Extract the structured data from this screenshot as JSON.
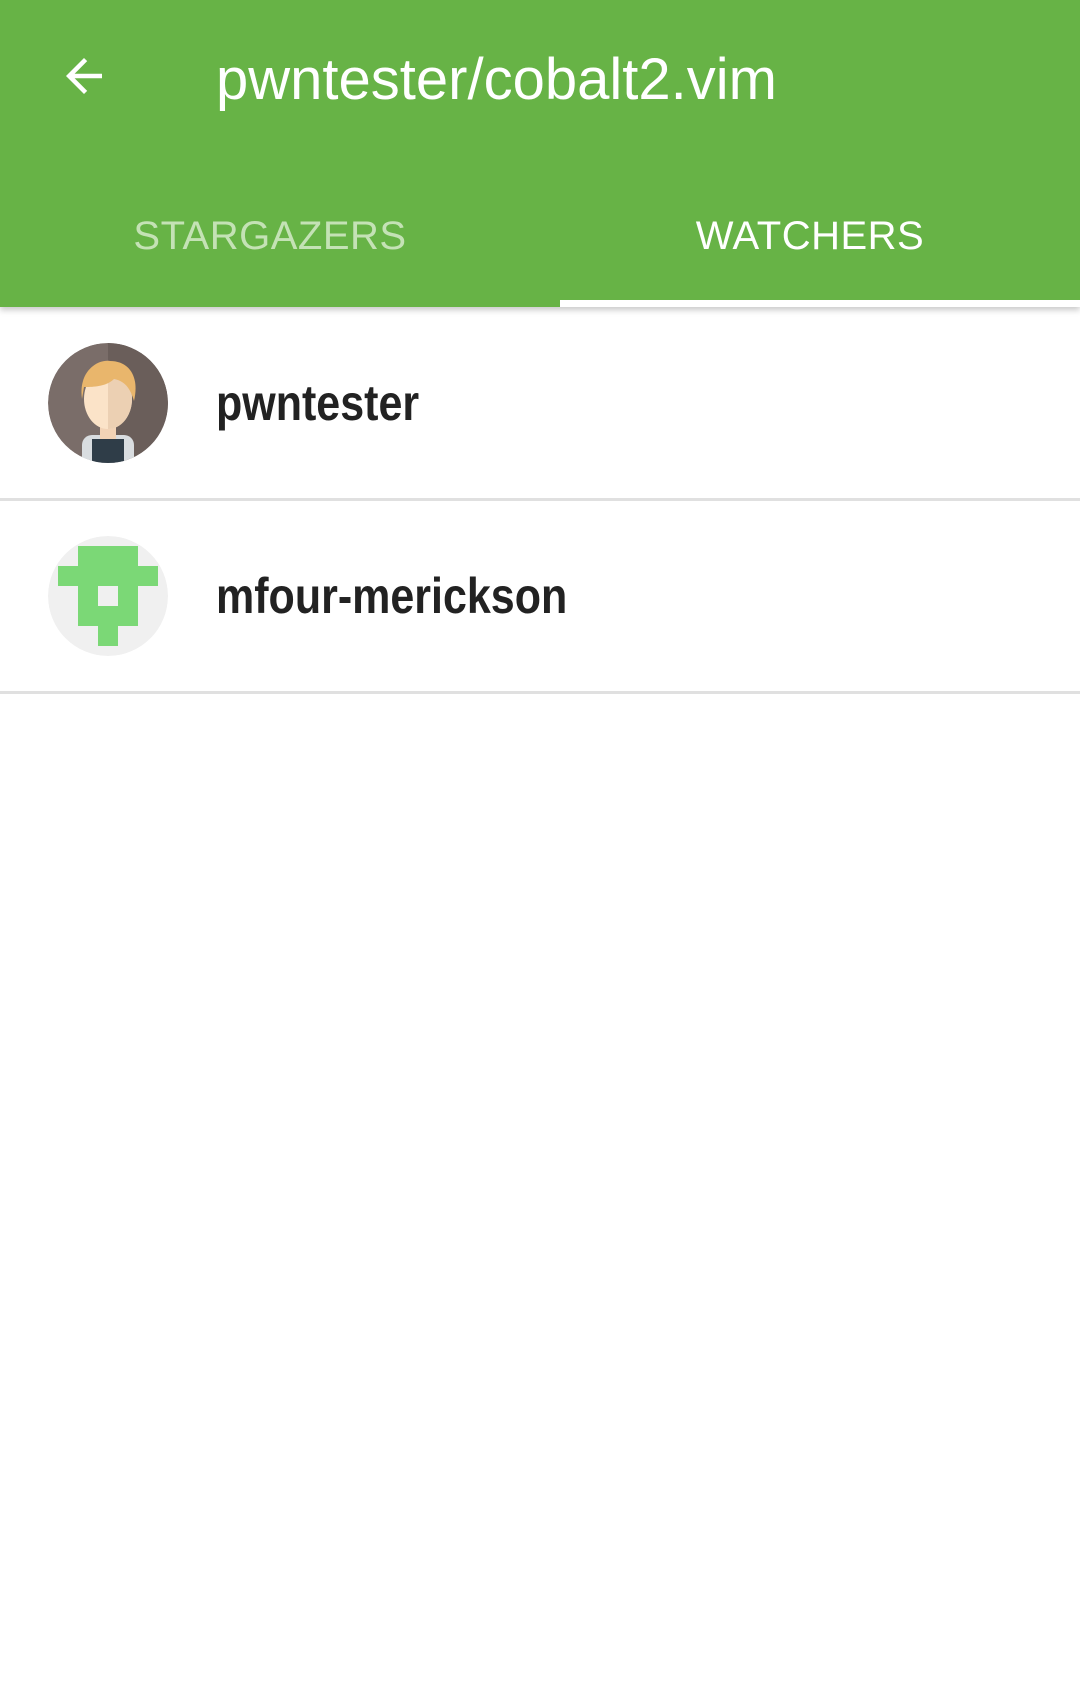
{
  "appbar": {
    "title": "pwntester/cobalt2.vim",
    "back_icon": "arrow-left-icon",
    "background_color": "#67b346"
  },
  "tabs": [
    {
      "label": "STARGAZERS",
      "active": false
    },
    {
      "label": "WATCHERS",
      "active": true
    }
  ],
  "watchers": [
    {
      "username": "pwntester",
      "avatar": "cartoon-person-avatar"
    },
    {
      "username": "mfour-merickson",
      "avatar": "green-identicon-avatar"
    }
  ]
}
